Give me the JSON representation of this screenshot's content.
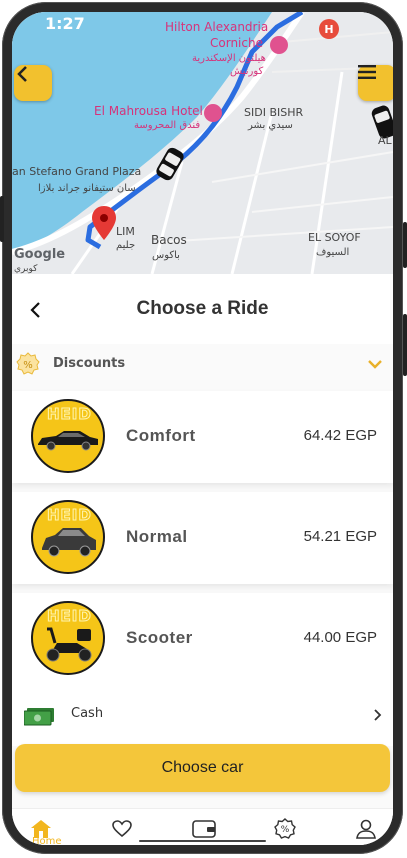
{
  "status": {
    "time": "1:27"
  },
  "map": {
    "places": [
      {
        "name": "Hilton Alexandria",
        "color": "pink"
      },
      {
        "name": "Corniche",
        "color": "pink"
      },
      {
        "name": "هيلتون الإسكندرية",
        "color": "pink"
      },
      {
        "name": "كورنيش",
        "color": "pink"
      },
      {
        "name": "El Mahrousa Hotel",
        "color": "pink"
      },
      {
        "name": "فندق المحروسة",
        "color": "pink"
      },
      {
        "name": "SIDI BISHR",
        "color": "dark"
      },
      {
        "name": "سيدي بشر",
        "color": "dark"
      },
      {
        "name": "an Stefano Grand Plaza",
        "color": "dark"
      },
      {
        "name": "سان ستيفانو جراند بلازا",
        "color": "dark"
      },
      {
        "name": "LIM",
        "color": "dark"
      },
      {
        "name": "جليم",
        "color": "dark"
      },
      {
        "name": "Bacos",
        "color": "dark"
      },
      {
        "name": "باكوس",
        "color": "dark"
      },
      {
        "name": "EL SOYOF",
        "color": "dark"
      },
      {
        "name": "السيوف",
        "color": "dark"
      },
      {
        "name": "AL",
        "color": "dark"
      },
      {
        "name": "Google",
        "color": "dark"
      },
      {
        "name": "كوبري",
        "color": "dark"
      }
    ]
  },
  "header": {
    "title": "Choose a Ride"
  },
  "discounts": {
    "label": "Discounts"
  },
  "rides": [
    {
      "name": "Comfort",
      "price": "64.42 EGP",
      "icon": "sedan-icon"
    },
    {
      "name": "Normal",
      "price": "54.21 EGP",
      "icon": "car-icon"
    },
    {
      "name": "Scooter",
      "price": "44.00 EGP",
      "icon": "scooter-icon"
    }
  ],
  "ride_logo": "HEID",
  "payment": {
    "label": "Cash"
  },
  "cta": {
    "label": "Choose car"
  },
  "nav": {
    "home_label": "Home"
  },
  "colors": {
    "accent": "#f4c63a",
    "pink": "#d6337a",
    "route": "#2b6de0"
  }
}
